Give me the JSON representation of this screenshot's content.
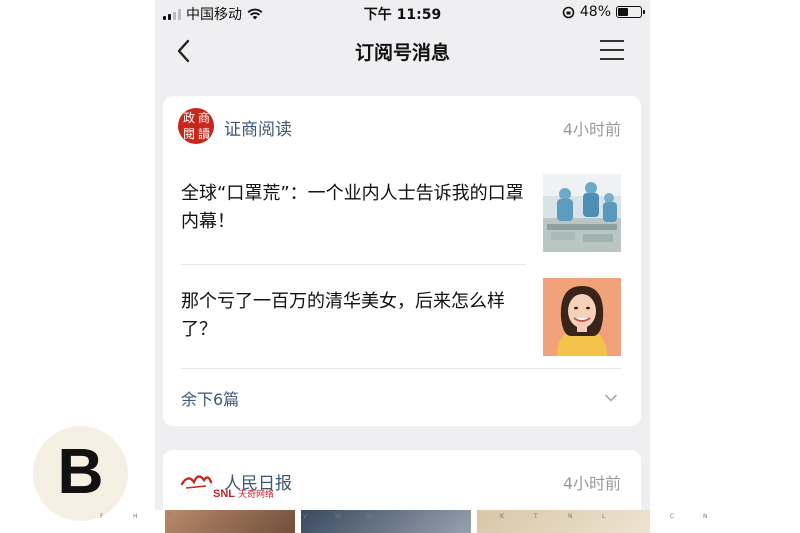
{
  "status_bar": {
    "carrier": "中国移动",
    "time": "下午 11:59",
    "battery": "48%",
    "battery_level": 0.48
  },
  "nav": {
    "title": "订阅号消息"
  },
  "card1": {
    "avatar_glyphs": [
      "政",
      "商",
      "閱",
      "讀"
    ],
    "source": "证商阅读",
    "time": "4小时前",
    "articles": [
      {
        "title": "全球“口罩荒”：一个业内人士告诉我的口罩内幕！"
      },
      {
        "title": "那个亏了一百万的清华美女，后来怎么样了？"
      }
    ],
    "more": "余下6篇"
  },
  "card2": {
    "source": "人民日报",
    "time": "4小时前",
    "banner_brand": "SNL",
    "banner_brand_cn": "天奇网络"
  },
  "watermark": {
    "letter": "B",
    "small_letters": [
      "F",
      "H",
      "T",
      "V",
      "W",
      "W",
      "K",
      "T",
      "N",
      "L",
      "C",
      "N"
    ]
  },
  "colors": {
    "link": "#3e5777",
    "avatar_red": "#c9261c",
    "page_bg": "#efeff1"
  }
}
